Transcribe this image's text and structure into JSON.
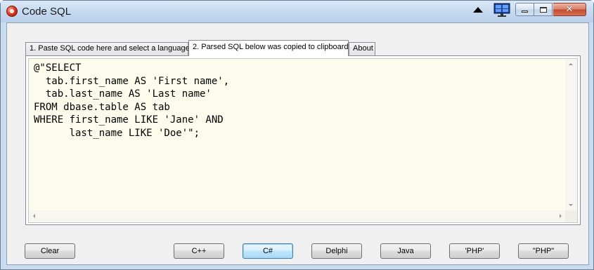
{
  "window": {
    "title": "Code SQL"
  },
  "tabs": [
    {
      "label": "1. Paste SQL code here and select a language"
    },
    {
      "label": "2. Parsed SQL below was copied to clipboard"
    },
    {
      "label": "About"
    }
  ],
  "editor": {
    "code": "@\"SELECT\n  tab.first_name AS 'First name',\n  tab.last_name AS 'Last name'\nFROM dbase.table AS tab\nWHERE first_name LIKE 'Jane' AND\n      last_name LIKE 'Doe'\";"
  },
  "buttons": {
    "clear": "Clear",
    "cpp": "C++",
    "csharp": "C#",
    "delphi": "Delphi",
    "java": "Java",
    "php_single": "'PHP'",
    "php_double": "\"PHP\""
  },
  "icons": {
    "app": "code-sql-app-icon",
    "up": "triangle-up-icon",
    "monitor": "monitor-icon",
    "minimize": "minimize-icon",
    "maximize": "maximize-icon",
    "close": "close-icon"
  }
}
